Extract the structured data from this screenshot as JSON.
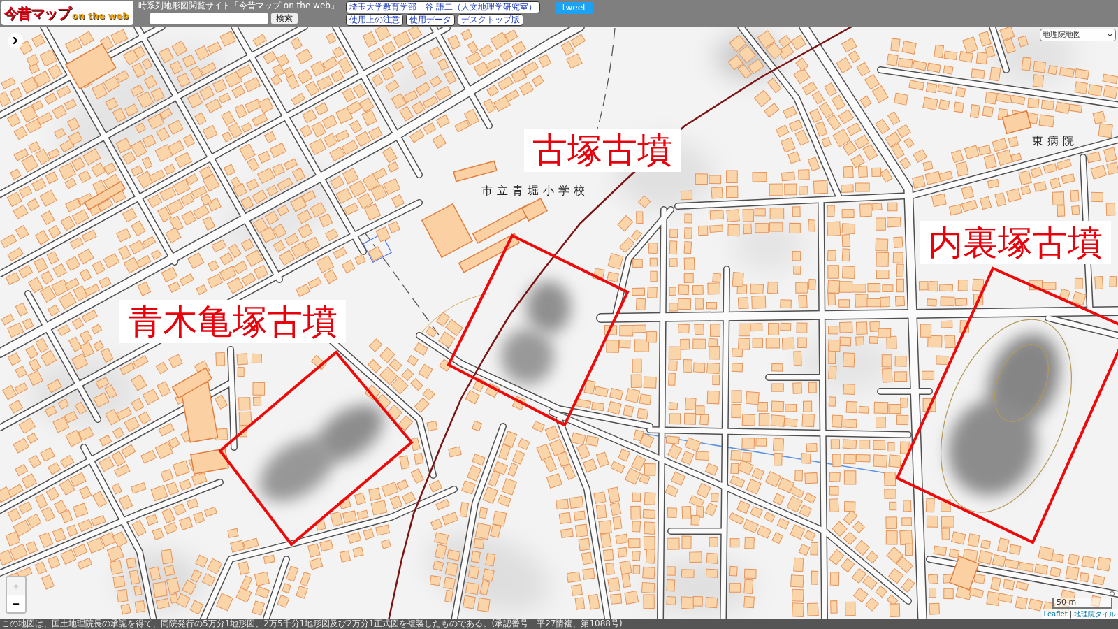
{
  "header": {
    "logo": {
      "title": "今昔マップ",
      "subtitle": "on the web"
    },
    "site_title": "時系列地形図閲覧サイト「今昔マップ on the web」",
    "search": {
      "button": "検索"
    },
    "links": [
      {
        "label": "埼玉大学教育学部　谷 謙二（人文地理学研究室）"
      },
      {
        "label": "使用上の注意"
      },
      {
        "label": "使用データ"
      },
      {
        "label": "デスクトップ版"
      }
    ],
    "tweet": "tweet"
  },
  "map": {
    "layer_select": {
      "value": "地理院地図"
    },
    "place_labels": [
      "東病院",
      "市立青堀小学校"
    ],
    "annotations": [
      {
        "label": "古塚古墳"
      },
      {
        "label": "内裏塚古墳"
      },
      {
        "label": "青木亀塚古墳"
      }
    ],
    "zoom_controls": [
      {
        "kind": "zoom_in",
        "disabled": true
      },
      {
        "kind": "zoom_out",
        "disabled": false
      }
    ],
    "scale": "50 m",
    "attribution": {
      "links": [
        "Leaflet",
        "地理院タイル"
      ],
      "separator": "|"
    }
  },
  "footer": {
    "notice": "この地図は、国土地理院長の承認を得て、同院発行の5万分1地形図、2万5千分1地形図及び2万分1正式図を複製したものである。(承認番号　平27情複、第1088号)"
  }
}
